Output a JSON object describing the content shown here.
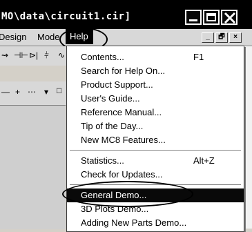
{
  "window": {
    "title": "MO\\data\\circuit1.cir]"
  },
  "menubar": {
    "items": [
      {
        "label": "Design"
      },
      {
        "label": "Mode"
      },
      {
        "label": "Help"
      }
    ]
  },
  "help_menu": {
    "items": [
      {
        "label": "Contents...",
        "shortcut": "F1"
      },
      {
        "label": "Search for Help On..."
      },
      {
        "label": "Product Support..."
      },
      {
        "label": "User's Guide..."
      },
      {
        "label": "Reference Manual..."
      },
      {
        "label": "Tip of the Day..."
      },
      {
        "label": "New MC8 Features..."
      },
      {
        "label": "Statistics...",
        "shortcut": "Alt+Z"
      },
      {
        "label": "Check for Updates..."
      },
      {
        "label": "General Demo..."
      },
      {
        "label": "3D Plots Demo..."
      },
      {
        "label": "Adding New Parts Demo..."
      }
    ],
    "selected": "General Demo..."
  },
  "icons": [
    "minimize-icon",
    "maximize-icon",
    "close-icon",
    "mdi-minimize-icon",
    "mdi-restore-icon",
    "mdi-close-icon"
  ],
  "colors": {
    "highlight": "#141414",
    "menu_bg": "#ffffff",
    "chrome": "#d4d0c8"
  }
}
